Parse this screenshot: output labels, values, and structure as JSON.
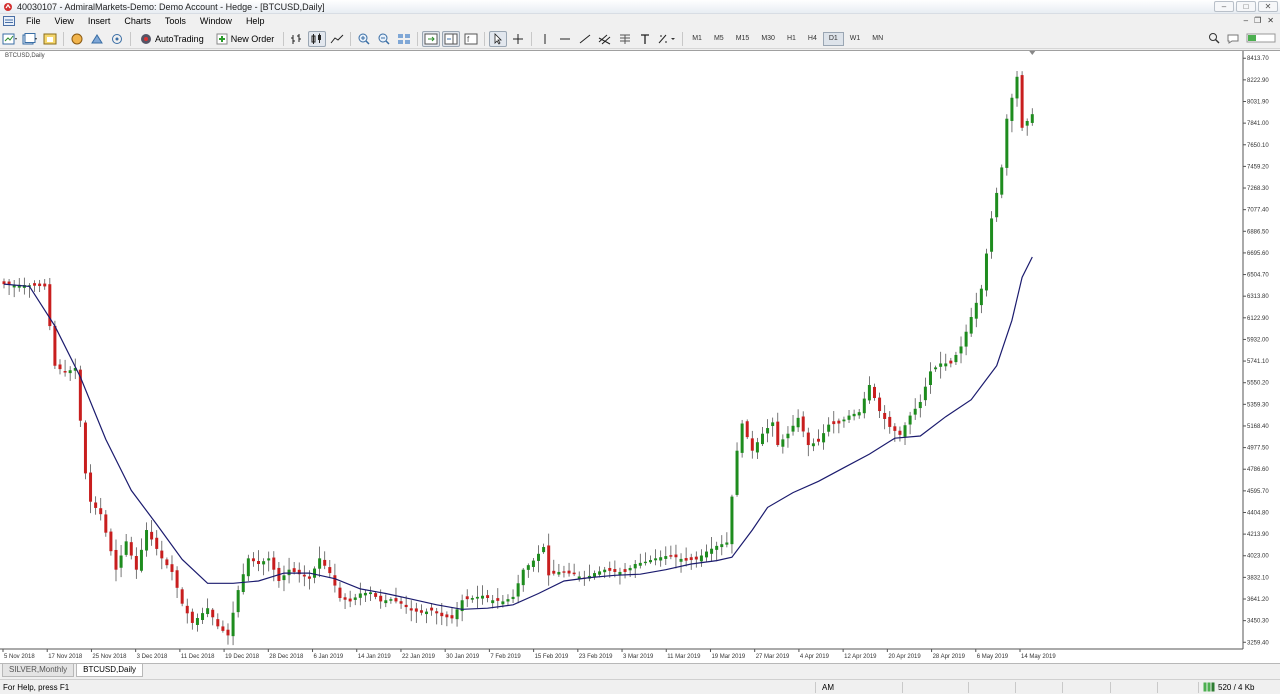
{
  "window": {
    "title": "40030107 - AdmiralMarkets-Demo: Demo Account - Hedge - [BTCUSD,Daily]"
  },
  "menu": [
    "File",
    "View",
    "Insert",
    "Charts",
    "Tools",
    "Window",
    "Help"
  ],
  "toolbar": {
    "autotrading_label": "AutoTrading",
    "new_order_label": "New Order",
    "timeframes": [
      "M1",
      "M5",
      "M15",
      "M30",
      "H1",
      "H4",
      "D1",
      "W1",
      "MN"
    ],
    "active_timeframe": "D1"
  },
  "chart": {
    "label": "BTCUSD,Daily",
    "colors": {
      "bull": "#1e8c1e",
      "bear": "#c81e1e",
      "ma": "#1b1b6e",
      "grid": "#e6e6e6"
    }
  },
  "chart_data": {
    "type": "candlestick",
    "symbol": "BTCUSD",
    "timeframe": "Daily",
    "price_ticks": [
      8413.7,
      8222.9,
      8031.9,
      7841.0,
      7650.1,
      7459.2,
      7268.3,
      7077.4,
      6886.5,
      6695.6,
      6504.7,
      6313.8,
      6122.9,
      5932.0,
      5741.1,
      5550.2,
      5359.3,
      5168.4,
      4977.5,
      4786.6,
      4595.7,
      4404.8,
      4213.9,
      4023.0,
      3832.1,
      3641.2,
      3450.3,
      3259.4
    ],
    "price_tick_labels": [
      "8413.70",
      "8222.90",
      "8031.90",
      "7841.00",
      "7650.10",
      "7459.20",
      "7268.30",
      "7077.40",
      "6886.50",
      "6695.60",
      "6504.70",
      "6313.80",
      "6122.90",
      "5932.00",
      "5741.10",
      "5550.20",
      "5359.30",
      "5168.40",
      "4977.50",
      "4786.60",
      "4595.70",
      "4404.80",
      "4213.90",
      "4023.00",
      "3832.10",
      "3641.20",
      "3450.30",
      "3259.40"
    ],
    "date_labels": [
      "5 Nov 2018",
      "17 Nov 2018",
      "25 Nov 2018",
      "3 Dec 2018",
      "11 Dec 2018",
      "19 Dec 2018",
      "28 Dec 2018",
      "6 Jan 2019",
      "14 Jan 2019",
      "22 Jan 2019",
      "30 Jan 2019",
      "7 Feb 2019",
      "15 Feb 2019",
      "23 Feb 2019",
      "3 Mar 2019",
      "11 Mar 2019",
      "19 Mar 2019",
      "27 Mar 2019",
      "4 Apr 2019",
      "12 Apr 2019",
      "20 Apr 2019",
      "28 Apr 2019",
      "6 May 2019",
      "14 May 2019"
    ],
    "close_path": [
      [
        0,
        6420
      ],
      [
        5,
        6410
      ],
      [
        8,
        6400
      ],
      [
        10,
        5700
      ],
      [
        12,
        5640
      ],
      [
        14,
        5680
      ],
      [
        16,
        4750
      ],
      [
        17,
        4500
      ],
      [
        19,
        4390
      ],
      [
        22,
        3900
      ],
      [
        24,
        4150
      ],
      [
        26,
        3900
      ],
      [
        28,
        4250
      ],
      [
        31,
        4000
      ],
      [
        33,
        3880
      ],
      [
        35,
        3600
      ],
      [
        37,
        3430
      ],
      [
        40,
        3560
      ],
      [
        42,
        3400
      ],
      [
        44,
        3320
      ],
      [
        46,
        3720
      ],
      [
        48,
        4000
      ],
      [
        50,
        3950
      ],
      [
        52,
        4000
      ],
      [
        54,
        3800
      ],
      [
        56,
        3900
      ],
      [
        58,
        3860
      ],
      [
        60,
        3820
      ],
      [
        62,
        4000
      ],
      [
        64,
        3870
      ],
      [
        66,
        3650
      ],
      [
        68,
        3620
      ],
      [
        70,
        3690
      ],
      [
        72,
        3700
      ],
      [
        74,
        3620
      ],
      [
        76,
        3640
      ],
      [
        78,
        3600
      ],
      [
        80,
        3540
      ],
      [
        82,
        3520
      ],
      [
        84,
        3540
      ],
      [
        86,
        3490
      ],
      [
        88,
        3470
      ],
      [
        90,
        3630
      ],
      [
        92,
        3650
      ],
      [
        94,
        3670
      ],
      [
        96,
        3630
      ],
      [
        98,
        3620
      ],
      [
        100,
        3660
      ],
      [
        102,
        3900
      ],
      [
        104,
        3980
      ],
      [
        106,
        4100
      ],
      [
        107,
        3850
      ],
      [
        109,
        3880
      ],
      [
        112,
        3860
      ],
      [
        114,
        3820
      ],
      [
        116,
        3870
      ],
      [
        118,
        3900
      ],
      [
        120,
        3880
      ],
      [
        122,
        3880
      ],
      [
        124,
        3950
      ],
      [
        126,
        3970
      ],
      [
        128,
        4000
      ],
      [
        130,
        4020
      ],
      [
        132,
        4010
      ],
      [
        134,
        3980
      ],
      [
        136,
        3990
      ],
      [
        138,
        4060
      ],
      [
        140,
        4110
      ],
      [
        142,
        4140
      ],
      [
        144,
        4950
      ],
      [
        145,
        5190
      ],
      [
        147,
        4950
      ],
      [
        149,
        5100
      ],
      [
        151,
        5200
      ],
      [
        152,
        5000
      ],
      [
        154,
        5100
      ],
      [
        156,
        5240
      ],
      [
        158,
        5000
      ],
      [
        160,
        5030
      ],
      [
        162,
        5180
      ],
      [
        164,
        5190
      ],
      [
        166,
        5260
      ],
      [
        168,
        5290
      ],
      [
        170,
        5530
      ],
      [
        172,
        5300
      ],
      [
        174,
        5160
      ],
      [
        176,
        5090
      ],
      [
        178,
        5260
      ],
      [
        180,
        5380
      ],
      [
        182,
        5650
      ],
      [
        184,
        5720
      ],
      [
        186,
        5720
      ],
      [
        188,
        5870
      ],
      [
        190,
        6130
      ],
      [
        192,
        6380
      ],
      [
        194,
        7000
      ],
      [
        196,
        7450
      ],
      [
        197,
        7880
      ],
      [
        199,
        8250
      ],
      [
        200,
        7800
      ],
      [
        202,
        7920
      ]
    ],
    "ma_path": [
      [
        0,
        6420
      ],
      [
        5,
        6400
      ],
      [
        10,
        6050
      ],
      [
        15,
        5600
      ],
      [
        20,
        5050
      ],
      [
        25,
        4600
      ],
      [
        30,
        4300
      ],
      [
        35,
        3990
      ],
      [
        40,
        3780
      ],
      [
        45,
        3780
      ],
      [
        50,
        3800
      ],
      [
        55,
        3870
      ],
      [
        60,
        3870
      ],
      [
        65,
        3820
      ],
      [
        70,
        3730
      ],
      [
        75,
        3690
      ],
      [
        80,
        3640
      ],
      [
        85,
        3590
      ],
      [
        90,
        3550
      ],
      [
        95,
        3560
      ],
      [
        100,
        3590
      ],
      [
        105,
        3690
      ],
      [
        110,
        3800
      ],
      [
        115,
        3830
      ],
      [
        120,
        3850
      ],
      [
        125,
        3860
      ],
      [
        130,
        3900
      ],
      [
        135,
        3950
      ],
      [
        140,
        3980
      ],
      [
        143,
        4010
      ],
      [
        147,
        4250
      ],
      [
        150,
        4450
      ],
      [
        155,
        4580
      ],
      [
        160,
        4680
      ],
      [
        165,
        4800
      ],
      [
        170,
        4920
      ],
      [
        175,
        5060
      ],
      [
        180,
        5080
      ],
      [
        185,
        5250
      ],
      [
        190,
        5400
      ],
      [
        195,
        5700
      ],
      [
        198,
        6100
      ],
      [
        200,
        6480
      ],
      [
        202,
        6660
      ]
    ],
    "ylim": [
      3200,
      8460
    ]
  },
  "tabs": [
    "SILVER,Monthly",
    "BTCUSD,Daily"
  ],
  "active_tab": "BTCUSD,Daily",
  "status": {
    "help": "For Help, press F1",
    "profile": "AM",
    "traffic": "520 / 4 Kb"
  }
}
